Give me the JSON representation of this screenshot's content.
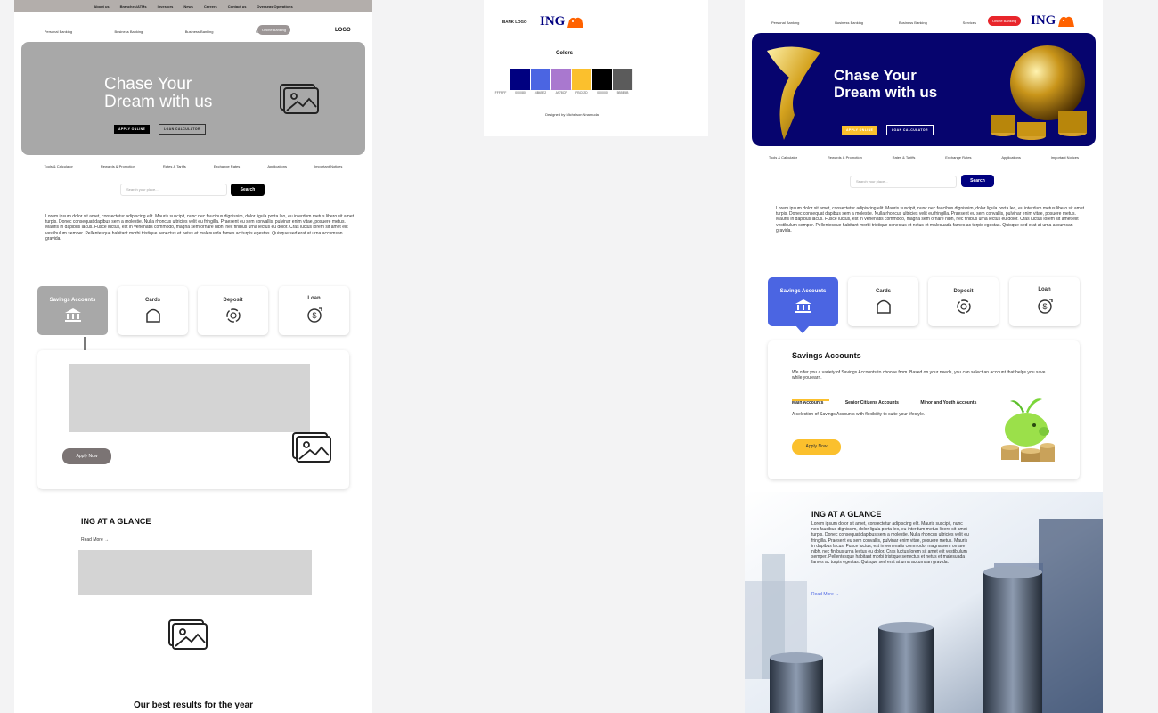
{
  "wireframe": {
    "top_nav": [
      "About us",
      "Branches/ATMs",
      "Investors",
      "News",
      "Careers",
      "Contact us",
      "Overseas Operations"
    ],
    "main_nav": [
      "Personal Banking",
      "Business Banking",
      "Business Banking",
      "Services"
    ],
    "online_banking": "Online Banking",
    "logo": "LOGO",
    "hero_title_line1": "Chase Your",
    "hero_title_line2": "Dream with us",
    "apply_online": "APPLY ONLINE",
    "loan_calculator": "LOAN CALCULATOR",
    "category_links": [
      "Tools & Calculator",
      "Rewards & Promotion",
      "Rates & Tariffs",
      "Exchange Rates",
      "Applications",
      "Important Notices"
    ],
    "search_placeholder": "Search your place...",
    "search_button": "Search",
    "lorem": "Lorem ipsum dolor sit amet, consectetur adipiscing elit. Mauris suscipit, nunc nec faucibus dignissim, dolor ligula porta leo, eu interdum metus libero sit amet turpis. Donec consequat dapibus sem a molestie. Nulla rhoncus ultricies velit eu fringilla. Praesent eu sem convallis, pulvinar enim vitae, posuere metus. Mauris in dapibus lacus. Fusce luctus, est in venenatis commodo, magna sem ornare nibh, nec finibus urna lectus eu dolor. Cras luctus lorem sit amet elit vestibulum semper. Pellentesque habitant morbi tristique senectus et netus et malesuada fames ac turpis egestas. Quisque sed erat at urna accumsan gravida.",
    "products": [
      "Savings Accounts",
      "Cards",
      "Deposit",
      "Loan"
    ],
    "apply_now": "Apply Now",
    "glance_title": "ING AT A GLANCE",
    "read_more": "Read More",
    "best_results": "Our best results for the year"
  },
  "style_guide": {
    "bank_logo_label": "BANK LOGO",
    "brand": "ING",
    "colors_title": "Colors",
    "colors": [
      "#FFFFFF",
      "#000080",
      "#4B65E2",
      "#A978CF",
      "#FBC02D",
      "#000000",
      "#5B5B5B"
    ],
    "color_labels": [
      "FFFFFF",
      "000080",
      "4B65E2",
      "A978CF",
      "FBC02D",
      "000000",
      "5B5B5B"
    ],
    "credit": "Designed by Michelson Nnamuda"
  },
  "hifi": {
    "main_nav": [
      "Personal Banking",
      "Business Banking",
      "Business Banking",
      "Services"
    ],
    "online_banking": "Online Banking",
    "brand": "ING",
    "hero_title_line1": "Chase Your",
    "hero_title_line2": "Dream with us",
    "apply_online": "APPLY ONLINE",
    "loan_calculator": "LOAN CALCULATOR",
    "category_links": [
      "Tools & Calculator",
      "Rewards & Promotion",
      "Rates & Tariffs",
      "Exchange Rates",
      "Applications",
      "Important Notices"
    ],
    "search_placeholder": "Search your place...",
    "search_button": "Search",
    "lorem": "Lorem ipsum dolor sit amet, consectetur adipiscing elit. Mauris suscipit, nunc nec faucibus dignissim, dolor ligula porta leo, eu interdum metus libero sit amet turpis. Donec consequat dapibus sem a molestie. Nulla rhoncus ultricies velit eu fringilla. Praesent eu sem convallis, pulvinar enim vitae, posuere metus. Mauris in dapibus lacus. Fusce luctus, est in venenatis commodo, magna sem ornare nibh, nec finibus urna lectus eu dolor. Cras luctus lorem sit amet elit vestibulum semper. Pellentesque habitant morbi tristique senectus et netus et malesuada fames ac turpis egestas. Quisque sed erat at urna accumsan gravida.",
    "products": [
      "Savings Accounts",
      "Cards",
      "Deposit",
      "Loan"
    ],
    "savings_title": "Savings Accounts",
    "savings_desc": "We offer you a variety of Savings Accounts to choose from. Based on your needs, you can select an account that helps you save while you earn.",
    "tabs": [
      "Main Accounts",
      "Senior Citizens Accounts",
      "Minor and Youth Accounts"
    ],
    "tab_desc": "A selection of Savings Accounts with flexibility to suite your lifestyle.",
    "apply_now": "Apply Now",
    "glance_title": "ING AT A GLANCE",
    "glance_text": "Lorem ipsum dolor sit amet, consectetur adipiscing elit. Mauris suscipit, nunc nec faucibus dignissim, dolor ligula porta leo, eu interdum metus libero sit amet turpis. Donec consequat dapibus sem a molestie. Nulla rhoncus ultricies velit eu fringilla. Praesent eu sem convallis, pulvinar enim vitae, posuere metus. Mauris in dapibus lacus. Fusce luctus, est in venenatis commodo, magna sem ornare nibh, nec finibus urna lectus eu dolor. Cras luctus lorem sit amet elit vestibulum semper. Pellentesque habitant morbi tristique senectus et netus et malesuada fames ac turpis egestas. Quisque sed erat at urna accumsan gravida.",
    "read_more": "Read More"
  },
  "colors": {
    "navy": "#000080",
    "blue": "#4B65E2",
    "yellow": "#FBC02D",
    "red": "#e8262b",
    "orange": "#ff6200"
  }
}
